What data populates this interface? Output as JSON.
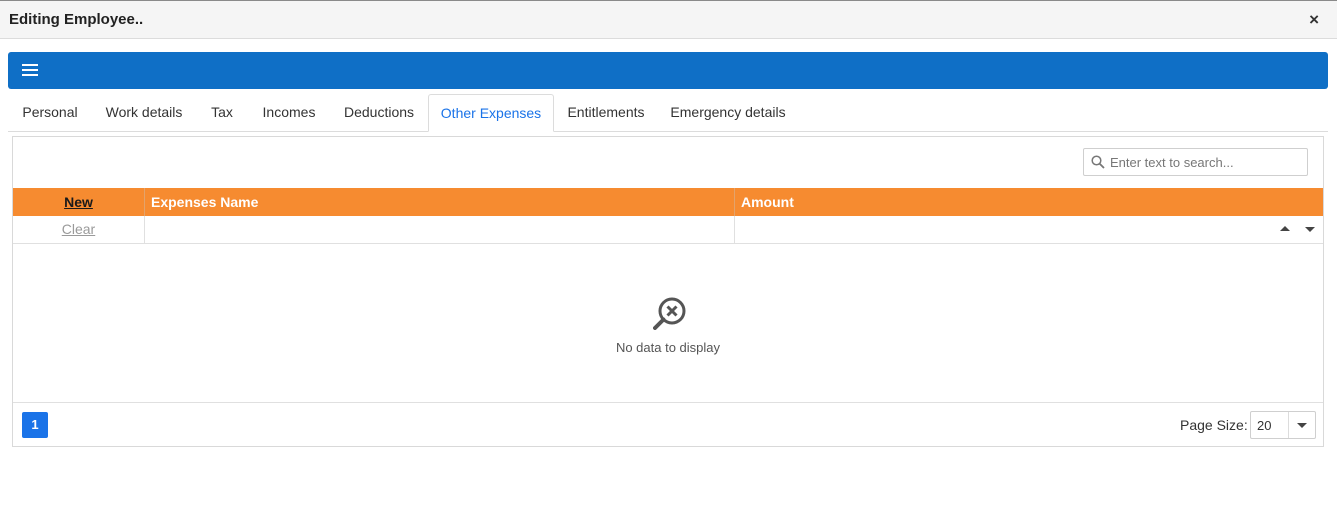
{
  "window": {
    "title": "Editing Employee..",
    "close_label": "×"
  },
  "toolbar": {
    "menu_icon": "hamburger-menu-icon",
    "color": "#0f6fc6"
  },
  "tabs": [
    {
      "label": "Personal",
      "active": false
    },
    {
      "label": "Work details",
      "active": false
    },
    {
      "label": "Tax",
      "active": false
    },
    {
      "label": "Incomes",
      "active": false
    },
    {
      "label": "Deductions",
      "active": false
    },
    {
      "label": "Other Expenses",
      "active": true
    },
    {
      "label": "Entitlements",
      "active": false
    },
    {
      "label": "Emergency details",
      "active": false
    }
  ],
  "search": {
    "placeholder": "Enter text to search...",
    "value": ""
  },
  "grid": {
    "header_color": "#f68b30",
    "columns": [
      {
        "label": "New"
      },
      {
        "label": "Expenses Name"
      },
      {
        "label": "Amount"
      }
    ],
    "filter_row": {
      "clear_label": "Clear"
    },
    "rows": [],
    "empty_text": "No data to display"
  },
  "pager": {
    "current_page": "1",
    "page_size_label": "Page Size:",
    "page_size": "20"
  }
}
